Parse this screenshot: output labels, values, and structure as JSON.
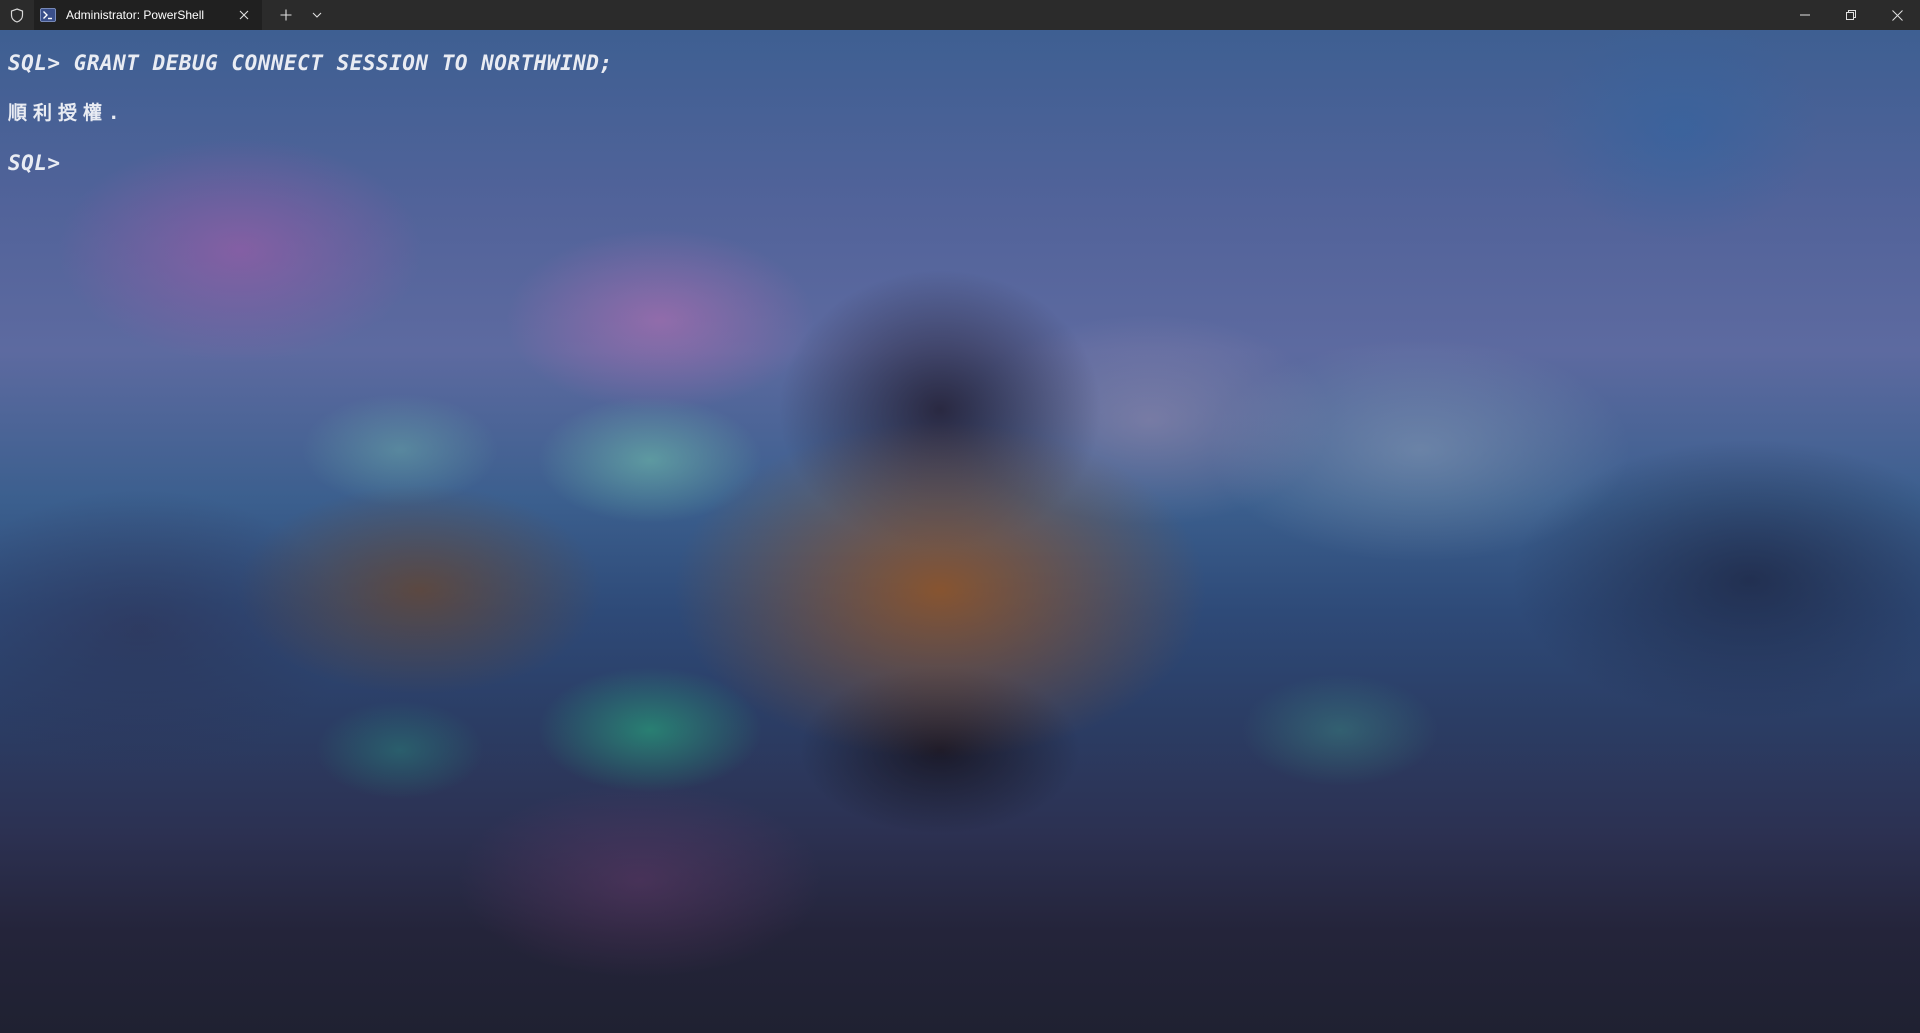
{
  "titlebar": {
    "shield_icon": "shield-icon",
    "tab": {
      "icon": "powershell-icon",
      "title": "Administrator: PowerShell",
      "close_icon": "close-icon"
    },
    "new_tab_icon": "plus-icon",
    "dropdown_icon": "chevron-down-icon",
    "window_controls": [
      "minimize-icon",
      "restore-icon",
      "close-icon"
    ]
  },
  "terminal": {
    "lines": [
      "SQL> GRANT DEBUG CONNECT SESSION TO NORTHWIND;",
      "順利授權.",
      "SQL>"
    ],
    "text_color": "#e9ecf3"
  }
}
